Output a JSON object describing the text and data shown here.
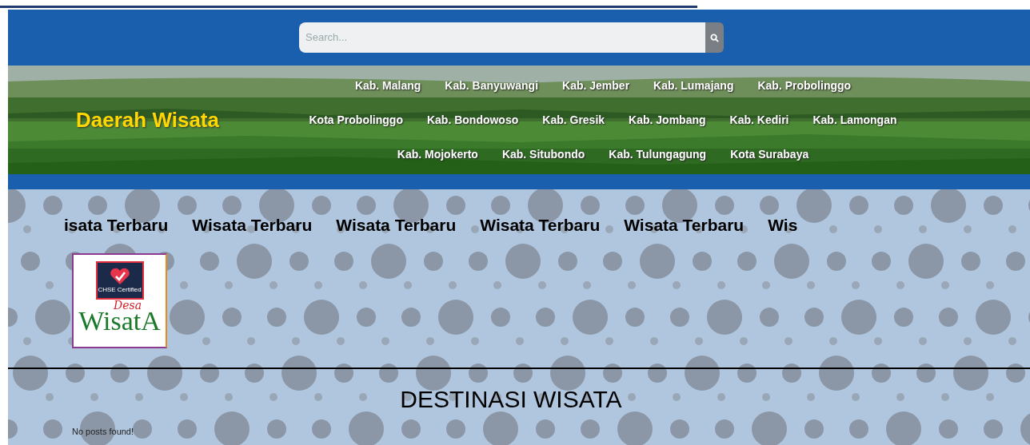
{
  "search": {
    "placeholder": "Search..."
  },
  "banner": {
    "title": "Daerah Wisata",
    "nav_rows": [
      [
        "Kab. Malang",
        "Kab. Banyuwangi",
        "Kab. Jember",
        "Kab. Lumajang",
        "Kab. Probolinggo"
      ],
      [
        "Kota Probolinggo",
        "Kab. Bondowoso",
        "Kab. Gresik",
        "Kab. Jombang",
        "Kab. Kediri",
        "Kab. Lamongan"
      ],
      [
        "Kab. Mojokerto",
        "Kab. Situbondo",
        "Kab. Tulungagung",
        "Kota Surabaya"
      ]
    ]
  },
  "ticker": [
    "isata Terbaru",
    "Wisata Terbaru",
    "Wisata Terbaru",
    "Wisata Terbaru",
    "Wisata Terbaru",
    "Wis"
  ],
  "logo": {
    "badge": "CHSE Certified",
    "script": "Desa",
    "word": "WisatA"
  },
  "heading": "DESTINASI WISATA",
  "message": "No posts found!"
}
